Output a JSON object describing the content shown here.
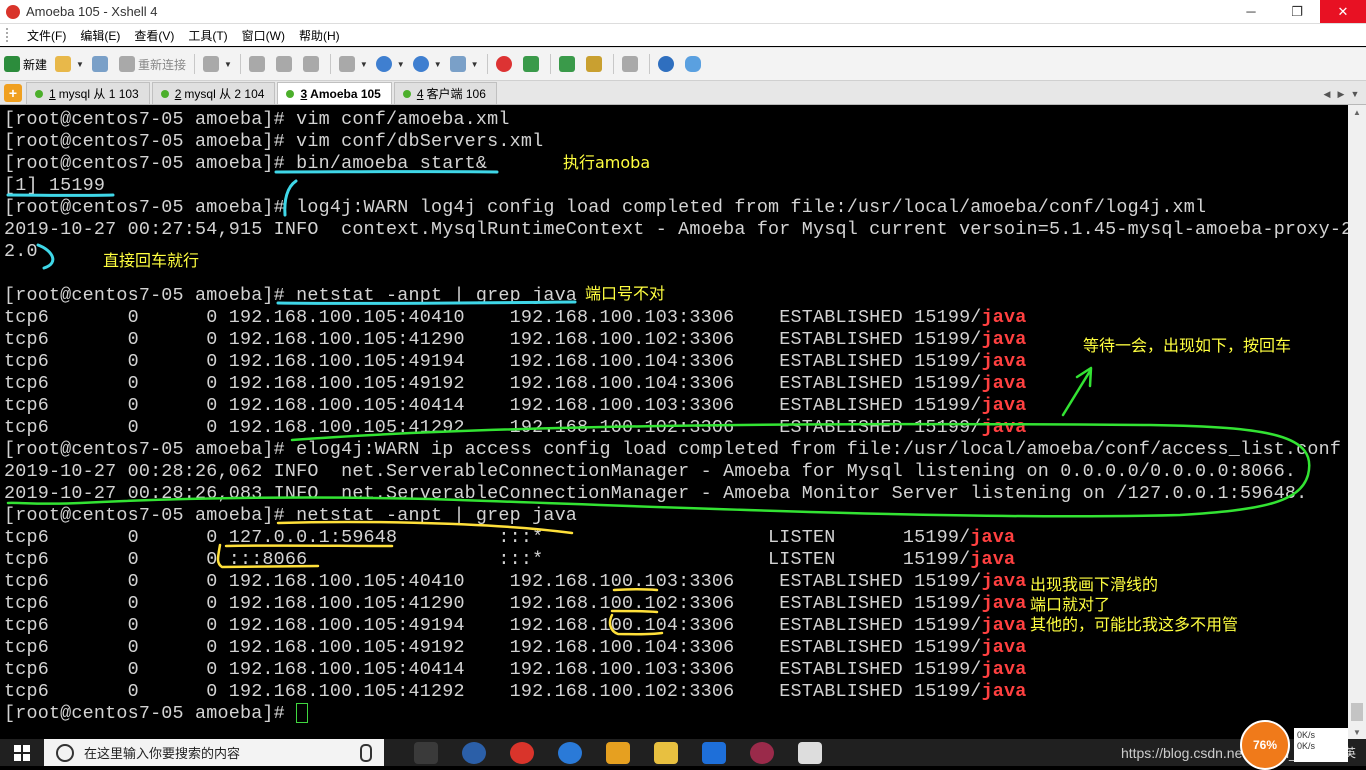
{
  "window": {
    "title": "Amoeba  105 - Xshell 4",
    "minimize": "─",
    "restore": "❐",
    "close": "✕"
  },
  "menu": [
    "文件(F)",
    "编辑(E)",
    "查看(V)",
    "工具(T)",
    "窗口(W)",
    "帮助(H)"
  ],
  "toolbar": {
    "new_label": "新建",
    "reconnect_label": "重新连接"
  },
  "tabs": [
    {
      "num": "1",
      "label": "mysql 从 1 103",
      "active": false
    },
    {
      "num": "2",
      "label": "mysql 从 2 104",
      "active": false
    },
    {
      "num": "3",
      "label": "Amoeba  105",
      "active": true
    },
    {
      "num": "4",
      "label": "客户端 106",
      "active": false
    }
  ],
  "terminal": {
    "lines": [
      "[root@centos7-05 amoeba]# vim conf/amoeba.xml",
      "[root@centos7-05 amoeba]# vim conf/dbServers.xml",
      "[root@centos7-05 amoeba]# bin/amoeba start&",
      "[1] 15199",
      "[root@centos7-05 amoeba]# log4j:WARN log4j config load completed from file:/usr/local/amoeba/conf/log4j.xml",
      "2019-10-27 00:27:54,915 INFO  context.MysqlRuntimeContext - Amoeba for Mysql current versoin=5.1.45-mysql-amoeba-proxy-2.",
      "2.0",
      "",
      "[root@centos7-05 amoeba]# netstat -anpt | grep java",
      "tcp6       0      0 192.168.100.105:40410    192.168.100.103:3306    ESTABLISHED 15199/",
      "tcp6       0      0 192.168.100.105:41290    192.168.100.102:3306    ESTABLISHED 15199/",
      "tcp6       0      0 192.168.100.105:49194    192.168.100.104:3306    ESTABLISHED 15199/",
      "tcp6       0      0 192.168.100.105:49192    192.168.100.104:3306    ESTABLISHED 15199/",
      "tcp6       0      0 192.168.100.105:40414    192.168.100.103:3306    ESTABLISHED 15199/",
      "tcp6       0      0 192.168.100.105:41292    192.168.100.102:3306    ESTABLISHED 15199/",
      "[root@centos7-05 amoeba]# elog4j:WARN ip access config load completed from file:/usr/local/amoeba/conf/access_list.conf",
      "2019-10-27 00:28:26,062 INFO  net.ServerableConnectionManager - Amoeba for Mysql listening on 0.0.0.0/0.0.0.0:8066.",
      "2019-10-27 00:28:26,083 INFO  net.ServerableConnectionManager - Amoeba Monitor Server listening on /127.0.0.1:59648.",
      "[root@centos7-05 amoeba]# netstat -anpt | grep java",
      "tcp6       0      0 127.0.0.1:59648         :::*                    LISTEN      15199/",
      "tcp6       0      0 :::8066                 :::*                    LISTEN      15199/",
      "tcp6       0      0 192.168.100.105:40410    192.168.100.103:3306    ESTABLISHED 15199/",
      "tcp6       0      0 192.168.100.105:41290    192.168.100.102:3306    ESTABLISHED 15199/",
      "tcp6       0      0 192.168.100.105:49194    192.168.100.104:3306    ESTABLISHED 15199/",
      "tcp6       0      0 192.168.100.105:49192    192.168.100.104:3306    ESTABLISHED 15199/",
      "tcp6       0      0 192.168.100.105:40414    192.168.100.103:3306    ESTABLISHED 15199/",
      "tcp6       0      0 192.168.100.105:41292    192.168.100.102:3306    ESTABLISHED 15199/",
      "[root@centos7-05 amoeba]# "
    ],
    "java_label": "java",
    "java_rows": [
      9,
      10,
      11,
      12,
      13,
      14,
      19,
      20,
      21,
      22,
      23,
      24,
      25,
      26
    ]
  },
  "annotations": {
    "exec": "执行amoba",
    "enter": "直接回车就行",
    "port_wrong": "端口号不对",
    "wait": "等待一会，出现如下，按回车",
    "underline_note": "出现我画下滑线的\n端口就对了\n其他的，可能比我这多不用管"
  },
  "taskbar": {
    "search_placeholder": "在这里输入你要搜索的内容",
    "watermark": "https://blog.csdn.net/weixin_4390",
    "ime": "英",
    "battery": "76%",
    "net_up": "0K/s",
    "net_down": "0K/s"
  },
  "colors": {
    "terminal_bg": "#000000",
    "terminal_fg": "#d3d3d3",
    "java_red": "#ff4040",
    "annotation_yellow": "#ffff40",
    "annotation_green": "#33e333",
    "annotation_cyan": "#3fd7e8"
  }
}
